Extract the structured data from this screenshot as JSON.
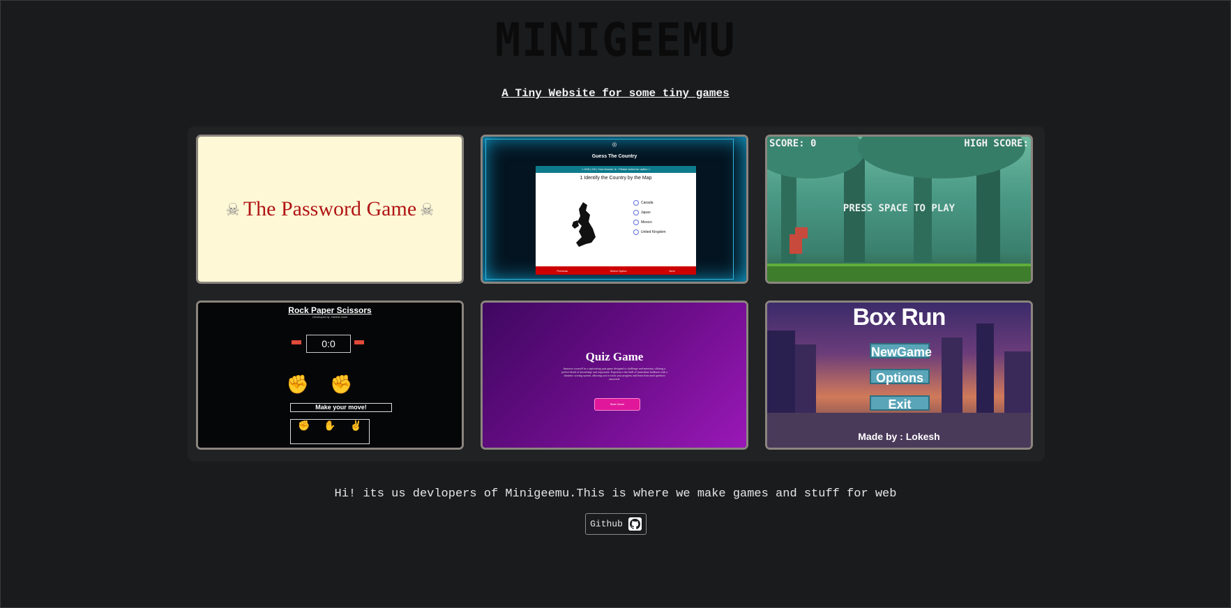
{
  "site": {
    "title": "MINIGEEMU",
    "tagline": "A Tiny Website for some tiny games"
  },
  "games": {
    "password": {
      "title": "The Password Game"
    },
    "country": {
      "title": "Guess The Country",
      "status_bar": "< 0/15 | 0/0 | Your Answer Is : Please select an option >",
      "question": "1 Identify the Country by the Map",
      "options": [
        "Canada",
        "Japan",
        "Mexico",
        "United Kingdom"
      ],
      "footer": [
        "Previous",
        "Select Option",
        "Next"
      ]
    },
    "dino": {
      "score_label": "SCORE: 0",
      "high_score_label": "HIGH SCORE:",
      "prompt": "PRESS SPACE TO PLAY"
    },
    "rps": {
      "title": "Rock Paper Scissors",
      "subtitle": "Developed by: Harshit Joshi",
      "score": "0:0",
      "prompt": "Make your move!",
      "choices": [
        "Rock",
        "Paper",
        "Scissors"
      ]
    },
    "quiz": {
      "title": "Quiz Game",
      "description": "Immerse yourself in a captivating quiz game designed to challenge and entertain, offering a perfect blend of knowledge and enjoyment. Experience the thrill of immediate feedback with a dynamic scoring system, allowing you to track your progress and learn from each question answered.",
      "button": "Start Game"
    },
    "boxrun": {
      "title": "Box Run",
      "buttons": [
        "NewGame",
        "Options",
        "Exit"
      ],
      "credit": "Made by : Lokesh"
    }
  },
  "about": {
    "text": "Hi! its us devlopers of Minigeemu.This is where we make games and stuff for web",
    "github_label": "Github"
  }
}
